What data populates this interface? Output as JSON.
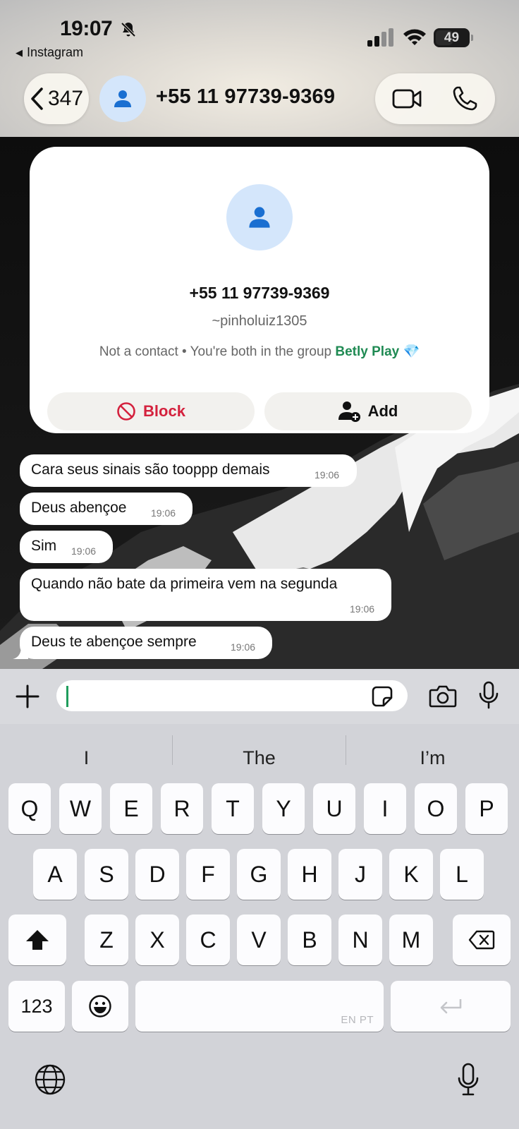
{
  "status_bar": {
    "time": "19:07",
    "back_app": "Instagram",
    "battery": "49",
    "icons": [
      "bell-slash-icon",
      "signal-icon",
      "wifi-icon",
      "battery-icon"
    ]
  },
  "header": {
    "back_count": "347",
    "title": "+55 11 97739-9369",
    "icons": [
      "chevron-left-icon",
      "person-icon",
      "video-camera-icon",
      "phone-icon"
    ]
  },
  "contact_card": {
    "number": "+55 11 97739-9369",
    "username": "~pinholuiz1305",
    "info_prefix": "Not a contact • You're both in the group ",
    "group_name": "Betly Play",
    "group_emoji": "💎",
    "block_label": "Block",
    "add_label": "Add"
  },
  "messages": [
    {
      "text": "Cara seus sinais são tooppp demais",
      "time": "19:06"
    },
    {
      "text": "Deus abençoe",
      "time": "19:06"
    },
    {
      "text": "Sim",
      "time": "19:06"
    },
    {
      "text": "Quando não bate da primeira vem na segunda",
      "time": "19:06"
    },
    {
      "text": "Deus te abençoe sempre",
      "time": "19:06"
    }
  ],
  "composer": {
    "value": "",
    "icons": [
      "plus-icon",
      "sticker-icon",
      "camera-icon",
      "microphone-icon"
    ]
  },
  "keyboard": {
    "suggestions": [
      "I",
      "The",
      "I’m"
    ],
    "row1": [
      "Q",
      "W",
      "E",
      "R",
      "T",
      "Y",
      "U",
      "I",
      "O",
      "P"
    ],
    "row2": [
      "A",
      "S",
      "D",
      "F",
      "G",
      "H",
      "J",
      "K",
      "L"
    ],
    "row3": [
      "Z",
      "X",
      "C",
      "V",
      "B",
      "N",
      "M"
    ],
    "numbers_label": "123",
    "space_language": "EN PT",
    "icons": [
      "shift-icon",
      "backspace-icon",
      "emoji-icon",
      "return-icon",
      "globe-icon",
      "microphone-icon"
    ]
  },
  "colors": {
    "accent_green": "#1f8a53",
    "block_red": "#d4213d",
    "avatar_bg": "#d4e6fb",
    "avatar_fg": "#1a6fd1"
  }
}
